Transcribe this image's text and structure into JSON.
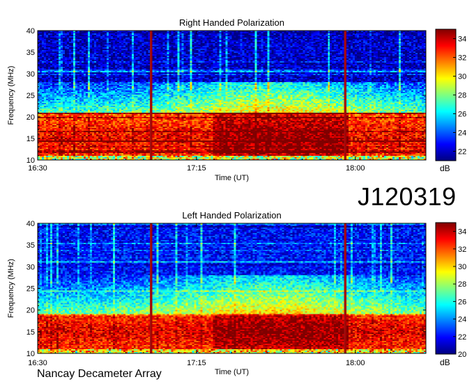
{
  "figure": {
    "id_label": "J120319",
    "footer": "Nancay Decameter Array"
  },
  "colormap": [
    "#00007f",
    "#0000ff",
    "#007fff",
    "#00ffff",
    "#7fff7f",
    "#ffff00",
    "#ff7f00",
    "#ff0000",
    "#7f0000"
  ],
  "chart_data": [
    {
      "type": "heatmap",
      "title": "Right Handed Polarization",
      "xlabel": "Time (UT)",
      "ylabel": "Frequency (MHz)",
      "x_ticks": [
        "16:30",
        "17:15",
        "18:00"
      ],
      "x_range_minutes_utc": [
        990,
        1100
      ],
      "ylim": [
        10,
        40
      ],
      "y_ticks": [
        10,
        15,
        20,
        25,
        30,
        35,
        40
      ],
      "colorbar": {
        "label": "dB",
        "range": [
          21,
          35
        ],
        "ticks": [
          22,
          24,
          26,
          28,
          30,
          32,
          34
        ]
      },
      "features": {
        "broadband_spikes_utc": [
          "17:02",
          "17:57"
        ],
        "strong_band_mhz": [
          11,
          21
        ],
        "moderate_band_mhz": [
          21,
          28
        ],
        "background_db": 22
      }
    },
    {
      "type": "heatmap",
      "title": "Left Handed Polarization",
      "xlabel": "Time (UT)",
      "ylabel": "Frequency (MHz)",
      "x_ticks": [
        "16:30",
        "17:15",
        "18:00"
      ],
      "x_range_minutes_utc": [
        990,
        1100
      ],
      "ylim": [
        10,
        40
      ],
      "y_ticks": [
        10,
        15,
        20,
        25,
        30,
        35,
        40
      ],
      "colorbar": {
        "label": "dB",
        "range": [
          20,
          35
        ],
        "ticks": [
          20,
          22,
          24,
          26,
          28,
          30,
          32,
          34
        ]
      },
      "features": {
        "broadband_spikes_utc": [
          "17:02",
          "17:57"
        ],
        "strong_band_mhz": [
          11,
          19
        ],
        "moderate_band_mhz": [
          19,
          28
        ],
        "background_db": 22
      }
    }
  ]
}
